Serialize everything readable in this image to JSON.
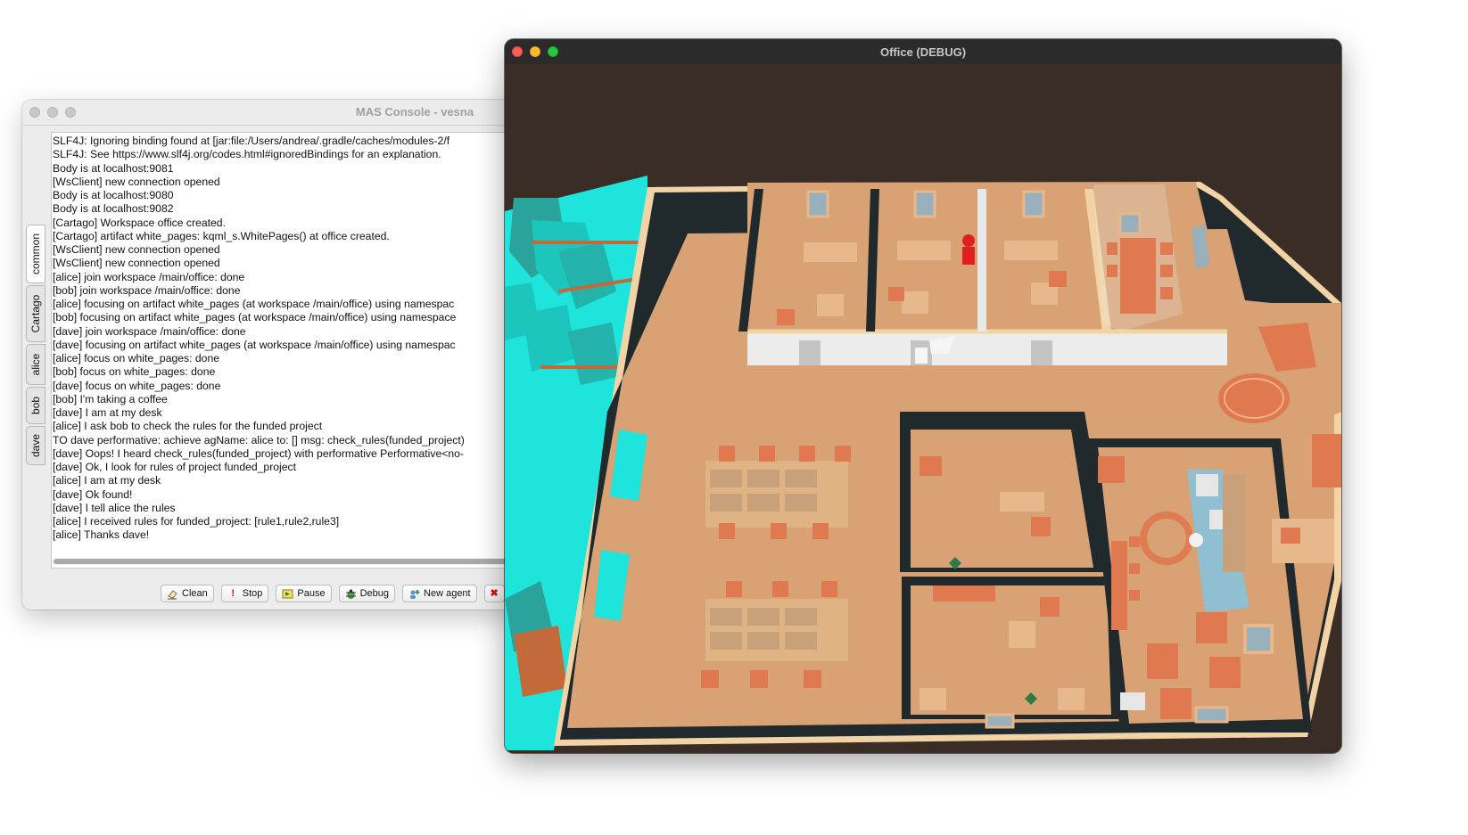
{
  "mas_console": {
    "title": "MAS Console - vesna",
    "tabs": [
      "common",
      "Cartago",
      "alice",
      "bob",
      "dave"
    ],
    "active_tab": "common",
    "log": [
      "SLF4J: Ignoring binding found at [jar:file:/Users/andrea/.gradle/caches/modules-2/f",
      "SLF4J: See https://www.slf4j.org/codes.html#ignoredBindings for an explanation.",
      "Body is at localhost:9081",
      "[WsClient] new connection opened",
      "Body is at localhost:9080",
      "Body is at localhost:9082",
      "[Cartago] Workspace office created.",
      "[Cartago] artifact white_pages: kqml_s.WhitePages() at office created.",
      "[WsClient] new connection opened",
      "[WsClient] new connection opened",
      "[alice] join workspace /main/office: done",
      "[bob] join workspace /main/office: done",
      "[alice] focusing on artifact white_pages (at workspace /main/office) using namespac",
      "[bob] focusing on artifact white_pages (at workspace /main/office) using namespace",
      "[dave] join workspace /main/office: done",
      "[dave] focusing on artifact white_pages (at workspace /main/office) using namespac",
      "[alice] focus on white_pages: done",
      "[bob] focus on white_pages: done",
      "[dave] focus on white_pages: done",
      "[bob] I'm taking a coffee",
      "[dave] I am at my desk",
      "[alice] I ask bob to check the rules for the funded project",
      "TO dave performative: achieve agName: alice to: [] msg: check_rules(funded_project)",
      "[dave] Oops! I heard check_rules(funded_project) with performative Performative<no-",
      "[dave] Ok, I look for rules of project funded_project",
      "[alice] I am at my desk",
      "[dave] Ok found!",
      "[dave] I tell alice the rules",
      "[alice] I received rules for funded_project: [rule1,rule2,rule3]",
      "[alice] Thanks dave!"
    ],
    "buttons": {
      "clean": "Clean",
      "stop": "Stop",
      "pause": "Pause",
      "debug": "Debug",
      "new_agent": "New agent"
    }
  },
  "office_window": {
    "title": "Office (DEBUG)"
  },
  "colors": {
    "floor": "#d8a274",
    "wall": "#20292c",
    "trim": "#f2d3a6",
    "water": "#1ee4dc",
    "furniture": "#e07850",
    "background": "#3a2d26"
  }
}
